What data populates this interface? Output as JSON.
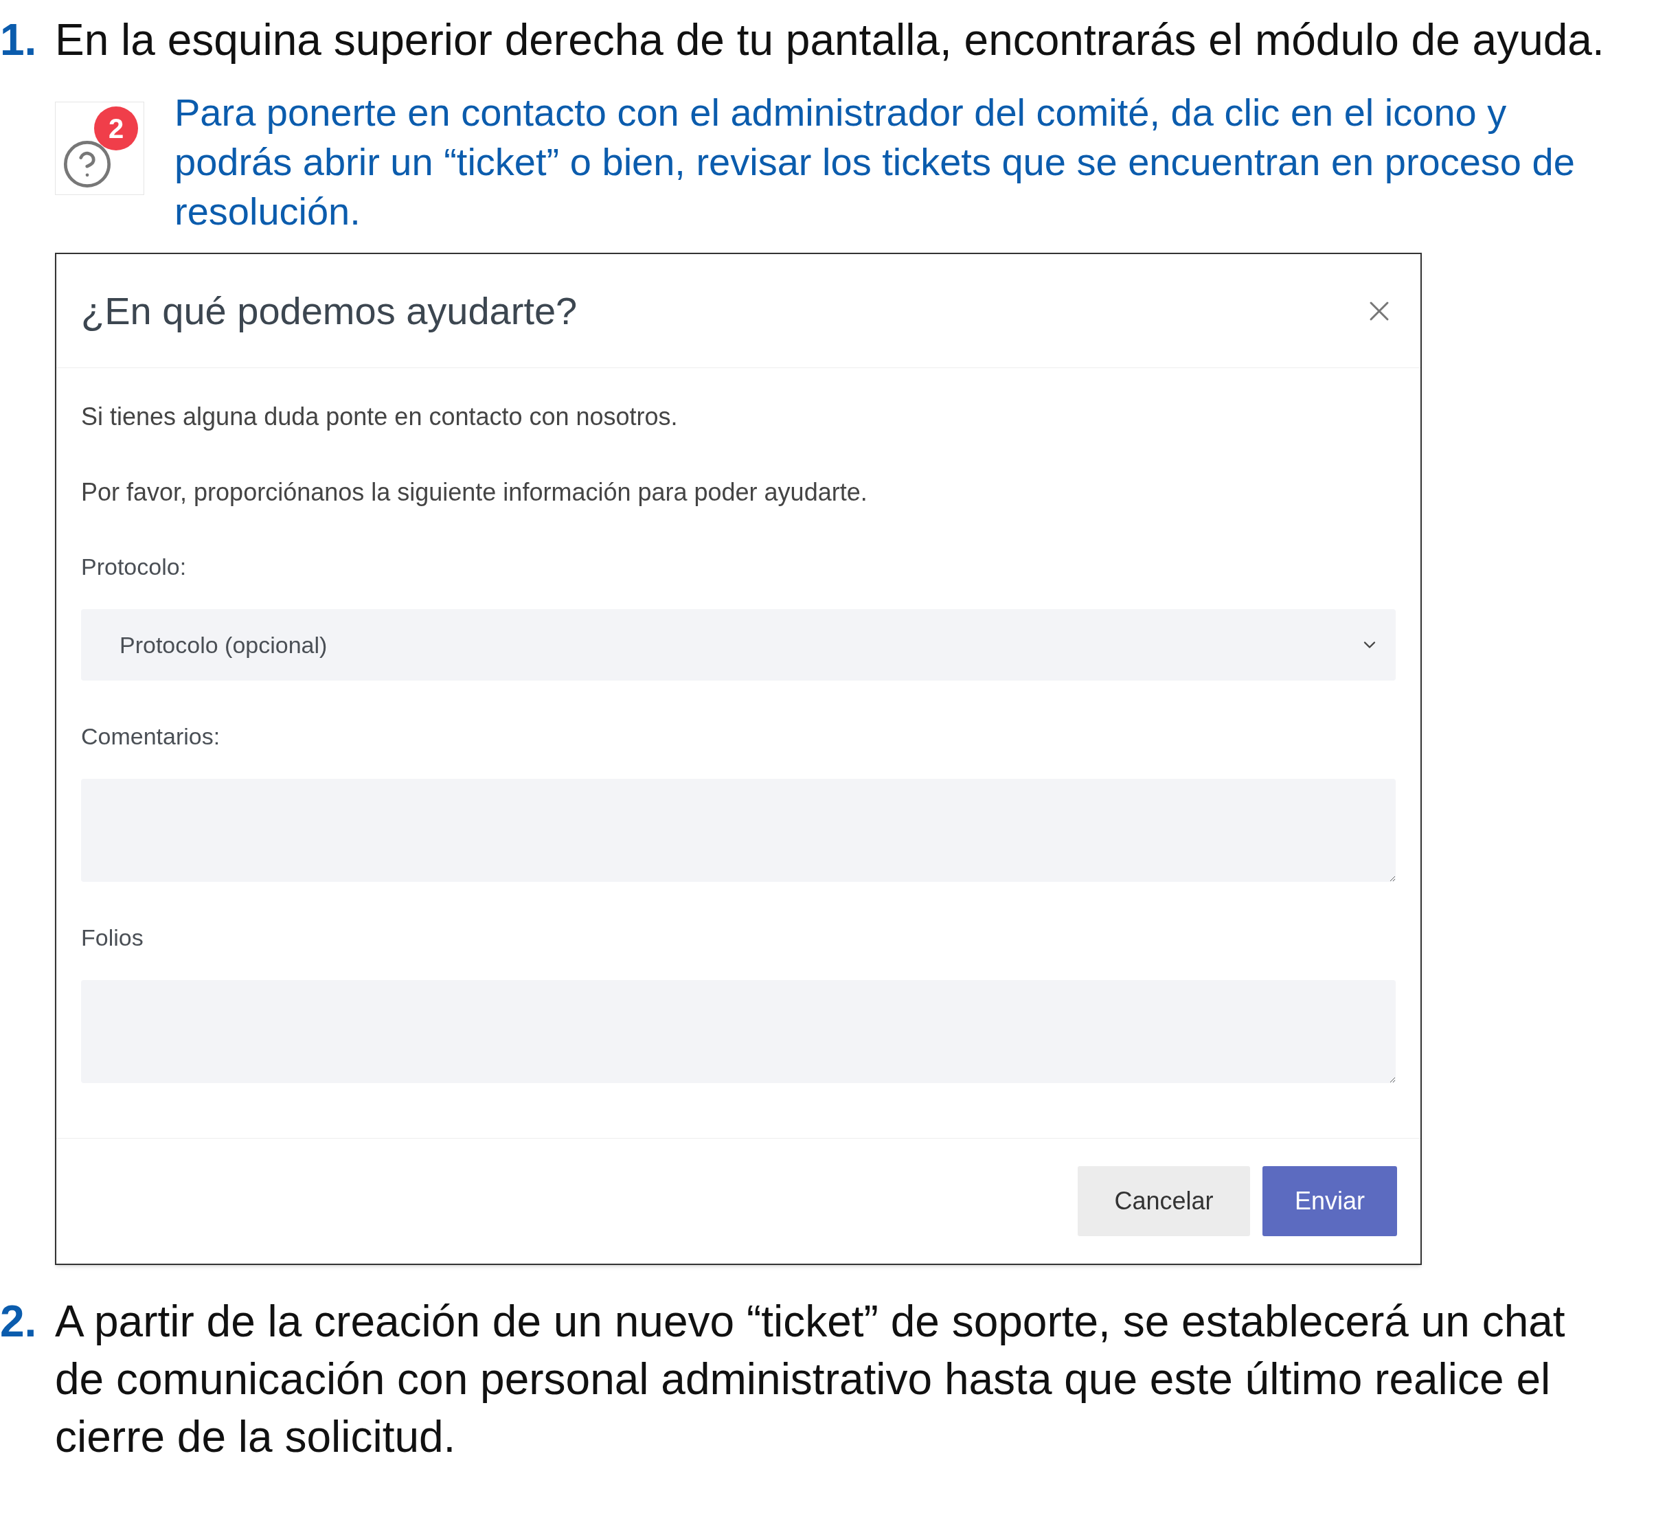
{
  "step_1": {
    "number": "1.",
    "text": "En la esquina superior derecha de tu pantalla, encontrarás el módulo de ayuda."
  },
  "help_note": {
    "badge": "2",
    "text": "Para ponerte en contacto con el administrador del comité, da clic en el icono y podrás abrir un “ticket” o bien, revisar los tickets que se encuentran en proceso de resolución."
  },
  "dialog": {
    "title": "¿En qué podemos ayudarte?",
    "intro": [
      "Si tienes alguna duda ponte en contacto con nosotros.",
      "Por favor, proporciónanos la siguiente información para poder ayudarte."
    ],
    "fields": [
      {
        "kind": "select",
        "label": "Protocolo:",
        "placeholder": "Protocolo (opcional)"
      },
      {
        "kind": "textarea",
        "label": "Comentarios:"
      },
      {
        "kind": "textarea",
        "label": "Folios"
      }
    ],
    "buttons": [
      {
        "label": "Cancelar",
        "kind": "secondary"
      },
      {
        "label": "Enviar",
        "kind": "primary"
      }
    ]
  },
  "step_2": {
    "number": "2.",
    "text": "A partir de la creación de un nuevo “ticket” de soporte, se establecerá un chat de comunicación con personal administrativo hasta que este último realice el cierre de la solicitud."
  }
}
